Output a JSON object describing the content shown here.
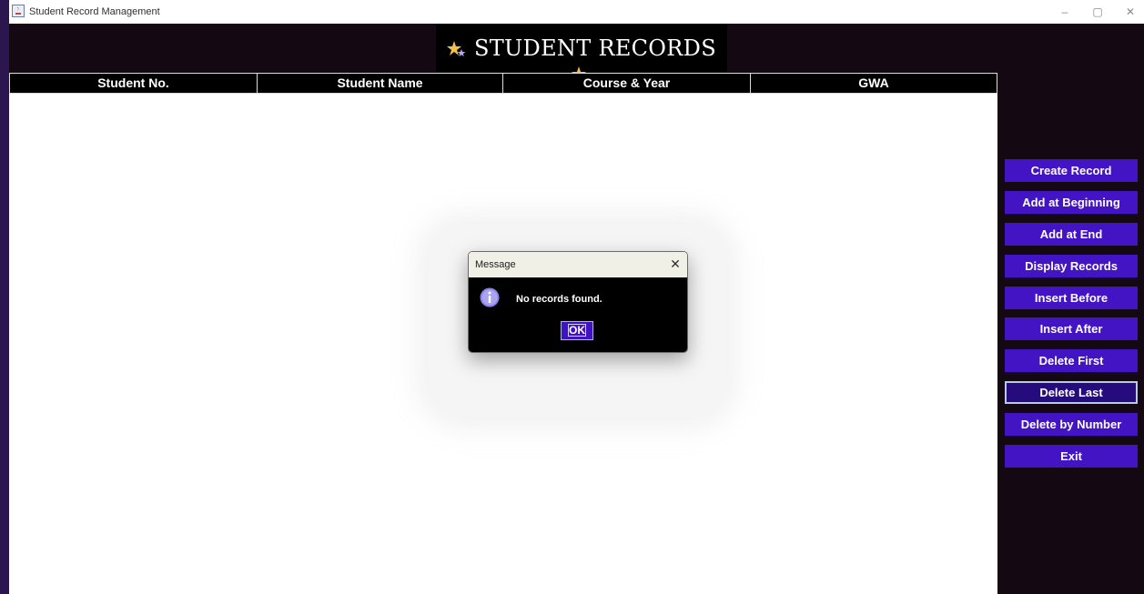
{
  "window": {
    "title": "Student Record Management",
    "app_icon": "java-icon",
    "controls": {
      "minimize": "–",
      "maximize": "▢",
      "close": "✕"
    }
  },
  "header": {
    "title": "STUDENT RECORDS",
    "decor_icon": "stars-icon"
  },
  "table": {
    "columns": [
      "Student No.",
      "Student Name",
      "Course & Year",
      "GWA"
    ],
    "rows": []
  },
  "buttons": [
    "Create Record",
    "Add at Beginning",
    "Add at End",
    "Display Records",
    "Insert Before",
    "Insert After",
    "Delete First",
    "Delete Last",
    "Delete by Number",
    "Exit"
  ],
  "dialog": {
    "title": "Message",
    "close": "✕",
    "icon": "info-icon",
    "message": "No records found.",
    "ok_label": "OK"
  },
  "colors": {
    "background": "#140812",
    "accent_button": "#4314c4",
    "focused_button": "#250b7c",
    "outer_border": "#2b1650"
  }
}
